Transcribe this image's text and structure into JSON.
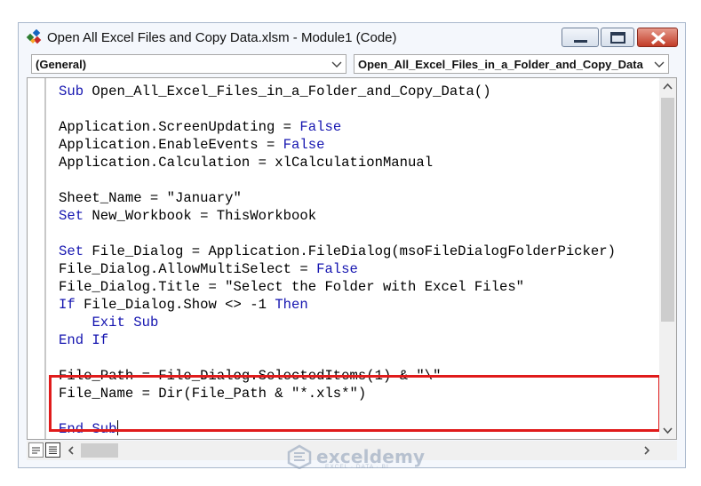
{
  "window": {
    "title": "Open All Excel Files and Copy Data.xlsm - Module1 (Code)"
  },
  "object_combo": {
    "value": "(General)"
  },
  "procedure_combo": {
    "value": "Open_All_Excel_Files_in_a_Folder_and_Copy_Data"
  },
  "code": {
    "lines": [
      [
        {
          "t": "Sub",
          "kw": true
        },
        {
          "t": " Open_All_Excel_Files_in_a_Folder_and_Copy_Data()"
        }
      ],
      [],
      [
        {
          "t": "Application.ScreenUpdating = "
        },
        {
          "t": "False",
          "kw": true
        }
      ],
      [
        {
          "t": "Application.EnableEvents = "
        },
        {
          "t": "False",
          "kw": true
        }
      ],
      [
        {
          "t": "Application.Calculation = xlCalculationManual"
        }
      ],
      [],
      [
        {
          "t": "Sheet_Name = \"January\""
        }
      ],
      [
        {
          "t": "Set",
          "kw": true
        },
        {
          "t": " New_Workbook = ThisWorkbook"
        }
      ],
      [],
      [
        {
          "t": "Set",
          "kw": true
        },
        {
          "t": " File_Dialog = Application.FileDialog(msoFileDialogFolderPicker)"
        }
      ],
      [
        {
          "t": "File_Dialog.AllowMultiSelect = "
        },
        {
          "t": "False",
          "kw": true
        }
      ],
      [
        {
          "t": "File_Dialog.Title = \"Select the Folder with Excel Files\""
        }
      ],
      [
        {
          "t": "If",
          "kw": true
        },
        {
          "t": " File_Dialog.Show <> -1 "
        },
        {
          "t": "Then",
          "kw": true
        }
      ],
      [
        {
          "t": "    "
        },
        {
          "t": "Exit Sub",
          "kw": true
        }
      ],
      [
        {
          "t": "End If",
          "kw": true
        }
      ],
      [],
      [
        {
          "t": "File_Path = File_Dialog.SelectedItems(1) & \"\\\""
        }
      ],
      [
        {
          "t": "File_Name = Dir(File_Path & \"*.xls*\")"
        }
      ],
      [],
      [
        {
          "t": "End Sub",
          "kw": true,
          "caret": true
        }
      ]
    ],
    "highlighted_lines": [
      16,
      17
    ]
  },
  "watermark": {
    "name": "exceldemy",
    "tagline": "EXCEL · DATA · BI"
  },
  "colors": {
    "keyword": "#1515b0",
    "highlight_border": "#e01b1b",
    "close_button": "#c23c28"
  },
  "icons": [
    "vba-app-icon",
    "minimize-icon",
    "maximize-icon",
    "close-icon",
    "dropdown-arrow-icon",
    "scroll-up-icon",
    "scroll-down-icon",
    "scroll-left-icon",
    "scroll-right-icon",
    "procedure-view-icon",
    "full-module-view-icon"
  ]
}
